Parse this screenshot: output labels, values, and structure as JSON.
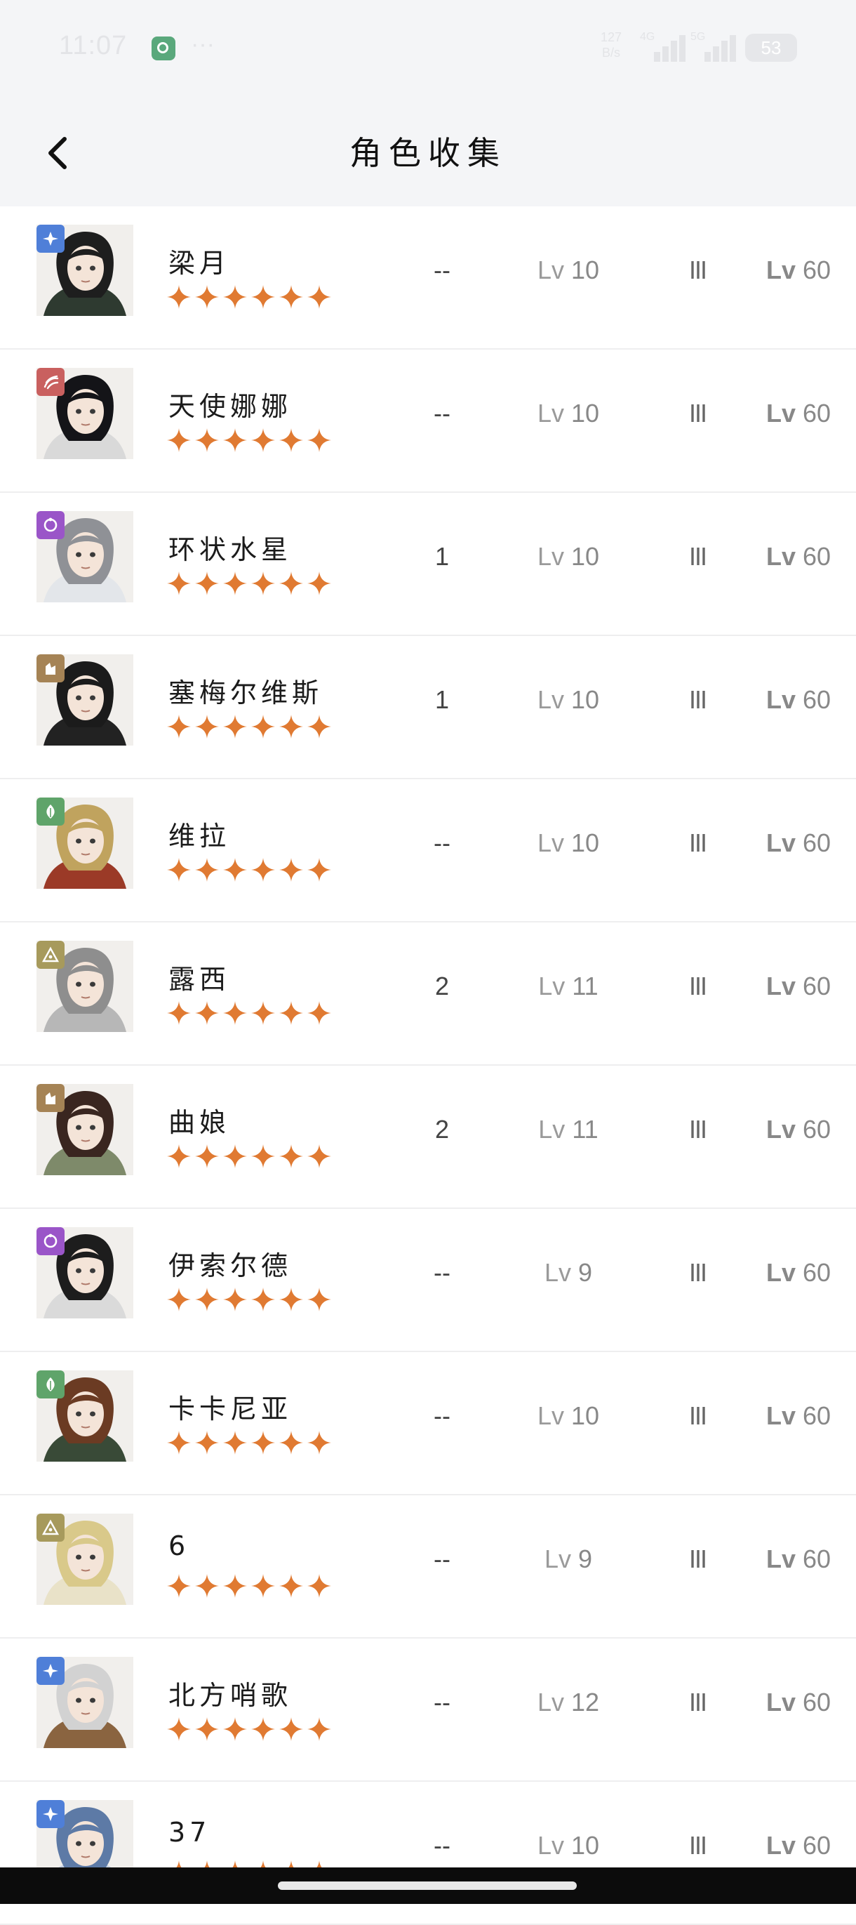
{
  "status_bar": {
    "time": "11:07",
    "dots": "···",
    "speed_value": "127",
    "speed_unit": "B/s",
    "signal1": "4G",
    "signal2": "5G",
    "battery": "53"
  },
  "header": {
    "title": "角色收集",
    "back_icon": "chevron-left-icon"
  },
  "colors": {
    "star": "#e07a32",
    "background": "#ffffff",
    "header": "#f4f5f7"
  },
  "characters": [
    {
      "name": "梁月",
      "element": "astral",
      "element_color": "#4f7fd8",
      "stars": 6,
      "dupes": "--",
      "level": "10",
      "rank": "III",
      "max_level": "60",
      "hair": "#1e1e1e",
      "cloth": "#2e3a30"
    },
    {
      "name": "天使娜娜",
      "element": "beast",
      "element_color": "#c9605f",
      "stars": 6,
      "dupes": "--",
      "level": "10",
      "rank": "III",
      "max_level": "60",
      "hair": "#141418",
      "cloth": "#d9d9d9"
    },
    {
      "name": "环状水星",
      "element": "mineral",
      "element_color": "#9a55c8",
      "stars": 6,
      "dupes": "1",
      "level": "10",
      "rank": "III",
      "max_level": "60",
      "hair": "#8f9196",
      "cloth": "#e3e6ea"
    },
    {
      "name": "塞梅尔维斯",
      "element": "intellect",
      "element_color": "#a58355",
      "stars": 6,
      "dupes": "1",
      "level": "10",
      "rank": "III",
      "max_level": "60",
      "hair": "#1b1b1b",
      "cloth": "#222"
    },
    {
      "name": "维拉",
      "element": "plant",
      "element_color": "#5fa46a",
      "stars": 6,
      "dupes": "--",
      "level": "10",
      "rank": "III",
      "max_level": "60",
      "hair": "#c0a35e",
      "cloth": "#9b3a27"
    },
    {
      "name": "露西",
      "element": "spirit",
      "element_color": "#a79a5c",
      "stars": 6,
      "dupes": "2",
      "level": "11",
      "rank": "III",
      "max_level": "60",
      "hair": "#8e8e8e",
      "cloth": "#b7b7b7"
    },
    {
      "name": "曲娘",
      "element": "intellect",
      "element_color": "#a58355",
      "stars": 6,
      "dupes": "2",
      "level": "11",
      "rank": "III",
      "max_level": "60",
      "hair": "#3a2620",
      "cloth": "#7e8a6a"
    },
    {
      "name": "伊索尔德",
      "element": "mineral",
      "element_color": "#9a55c8",
      "stars": 6,
      "dupes": "--",
      "level": "9",
      "rank": "III",
      "max_level": "60",
      "hair": "#1d1d1d",
      "cloth": "#dadada"
    },
    {
      "name": "卡卡尼亚",
      "element": "plant",
      "element_color": "#5fa46a",
      "stars": 6,
      "dupes": "--",
      "level": "10",
      "rank": "III",
      "max_level": "60",
      "hair": "#6b3b23",
      "cloth": "#394a37"
    },
    {
      "name": "6",
      "element": "spirit",
      "element_color": "#a79a5c",
      "stars": 6,
      "dupes": "--",
      "level": "9",
      "rank": "III",
      "max_level": "60",
      "hair": "#d9c98a",
      "cloth": "#e9e2c8"
    },
    {
      "name": "北方哨歌",
      "element": "astral",
      "element_color": "#4f7fd8",
      "stars": 6,
      "dupes": "--",
      "level": "12",
      "rank": "III",
      "max_level": "60",
      "hair": "#d2d2d2",
      "cloth": "#8a6440"
    },
    {
      "name": "37",
      "element": "astral",
      "element_color": "#4f7fd8",
      "stars": 6,
      "dupes": "--",
      "level": "10",
      "rank": "III",
      "max_level": "60",
      "hair": "#5d7aa6",
      "cloth": "#c9d4e4"
    }
  ],
  "labels": {
    "lv_prefix": "Lv"
  }
}
